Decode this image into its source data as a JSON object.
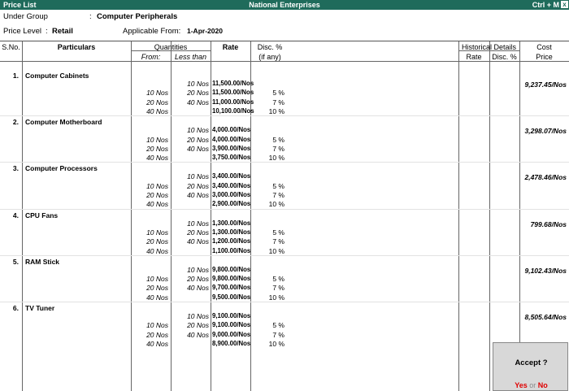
{
  "titlebar": {
    "left": "Price List",
    "center": "National Enterprises",
    "right": "Ctrl + M",
    "close": "x"
  },
  "header": {
    "under_group_label": "Under Group",
    "under_group_value": "Computer Peripherals",
    "price_level_label": "Price Level",
    "price_level_value": "Retail",
    "applicable_from_label": "Applicable From:",
    "applicable_from_value": "1-Apr-2020"
  },
  "columns": {
    "sno": "S.No.",
    "particulars": "Particulars",
    "quantities": "Quantities",
    "from": "From:",
    "less_than": "Less than",
    "rate": "Rate",
    "disc": "Disc. %",
    "if_any": "(if any)",
    "historical": "Historical Details",
    "hist_rate": "Rate",
    "hist_disc": "Disc. %",
    "cost": "Cost",
    "price": "Price"
  },
  "items": [
    {
      "sno": "1.",
      "name": "Computer Cabinets",
      "cost": "9,237.45/Nos",
      "slabs": [
        {
          "from": "",
          "less": "10 Nos",
          "rate": "11,500.00/Nos",
          "disc": ""
        },
        {
          "from": "10 Nos",
          "less": "20 Nos",
          "rate": "11,500.00/Nos",
          "disc": "5 %"
        },
        {
          "from": "20 Nos",
          "less": "40 Nos",
          "rate": "11,000.00/Nos",
          "disc": "7 %"
        },
        {
          "from": "40 Nos",
          "less": "",
          "rate": "10,100.00/Nos",
          "disc": "10 %"
        }
      ]
    },
    {
      "sno": "2.",
      "name": "Computer Motherboard",
      "cost": "3,298.07/Nos",
      "slabs": [
        {
          "from": "",
          "less": "10 Nos",
          "rate": "4,000.00/Nos",
          "disc": ""
        },
        {
          "from": "10 Nos",
          "less": "20 Nos",
          "rate": "4,000.00/Nos",
          "disc": "5 %"
        },
        {
          "from": "20 Nos",
          "less": "40 Nos",
          "rate": "3,900.00/Nos",
          "disc": "7 %"
        },
        {
          "from": "40 Nos",
          "less": "",
          "rate": "3,750.00/Nos",
          "disc": "10 %"
        }
      ]
    },
    {
      "sno": "3.",
      "name": "Computer Processors",
      "cost": "2,478.46/Nos",
      "slabs": [
        {
          "from": "",
          "less": "10 Nos",
          "rate": "3,400.00/Nos",
          "disc": ""
        },
        {
          "from": "10 Nos",
          "less": "20 Nos",
          "rate": "3,400.00/Nos",
          "disc": "5 %"
        },
        {
          "from": "20 Nos",
          "less": "40 Nos",
          "rate": "3,000.00/Nos",
          "disc": "7 %"
        },
        {
          "from": "40 Nos",
          "less": "",
          "rate": "2,900.00/Nos",
          "disc": "10 %"
        }
      ]
    },
    {
      "sno": "4.",
      "name": "CPU Fans",
      "cost": "799.68/Nos",
      "slabs": [
        {
          "from": "",
          "less": "10 Nos",
          "rate": "1,300.00/Nos",
          "disc": ""
        },
        {
          "from": "10 Nos",
          "less": "20 Nos",
          "rate": "1,300.00/Nos",
          "disc": "5 %"
        },
        {
          "from": "20 Nos",
          "less": "40 Nos",
          "rate": "1,200.00/Nos",
          "disc": "7 %"
        },
        {
          "from": "40 Nos",
          "less": "",
          "rate": "1,100.00/Nos",
          "disc": "10 %"
        }
      ]
    },
    {
      "sno": "5.",
      "name": "RAM Stick",
      "cost": "9,102.43/Nos",
      "slabs": [
        {
          "from": "",
          "less": "10 Nos",
          "rate": "9,800.00/Nos",
          "disc": ""
        },
        {
          "from": "10 Nos",
          "less": "20 Nos",
          "rate": "9,800.00/Nos",
          "disc": "5 %"
        },
        {
          "from": "20 Nos",
          "less": "40 Nos",
          "rate": "9,700.00/Nos",
          "disc": "7 %"
        },
        {
          "from": "40 Nos",
          "less": "",
          "rate": "9,500.00/Nos",
          "disc": "10 %"
        }
      ]
    },
    {
      "sno": "6.",
      "name": "TV Tuner",
      "cost": "8,505.64/Nos",
      "slabs": [
        {
          "from": "",
          "less": "10 Nos",
          "rate": "9,100.00/Nos",
          "disc": ""
        },
        {
          "from": "10 Nos",
          "less": "20 Nos",
          "rate": "9,100.00/Nos",
          "disc": "5 %"
        },
        {
          "from": "20 Nos",
          "less": "40 Nos",
          "rate": "9,000.00/Nos",
          "disc": "7 %"
        },
        {
          "from": "40 Nos",
          "less": "",
          "rate": "8,900.00/Nos",
          "disc": "10 %"
        }
      ]
    }
  ],
  "accept": {
    "question": "Accept ?",
    "yes": "Yes",
    "or": "or",
    "no": "No"
  }
}
